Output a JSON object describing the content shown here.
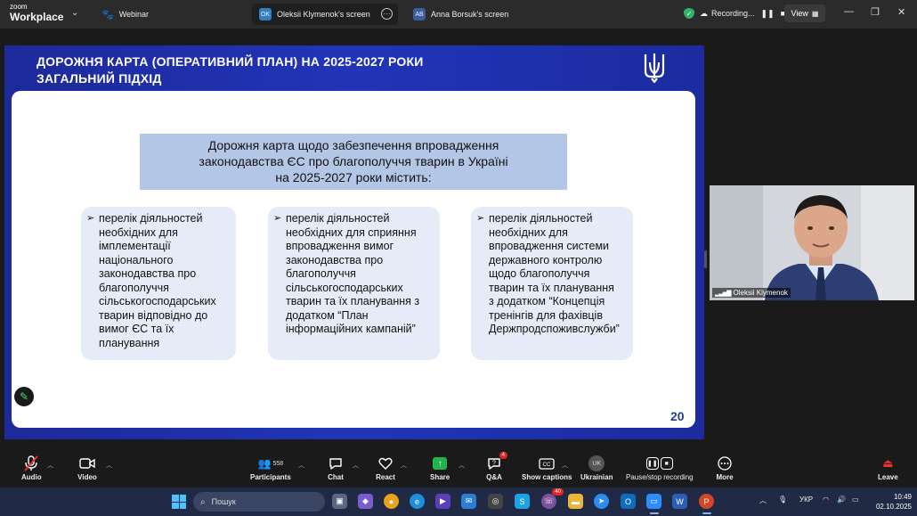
{
  "app": {
    "logo_line1": "zoom",
    "logo_line2": "Workplace",
    "tabs": [
      {
        "icon": "paw-icon",
        "label": "Webinar"
      },
      {
        "avatar": "OK",
        "label": "Oleksii Klymenok's screen",
        "avatar_color": "#2f7fc1"
      },
      {
        "avatar": "AB",
        "label": "Anna Borsuk's screen",
        "avatar_color": "#3b5d9c"
      }
    ],
    "recording_label": "Recording...",
    "view_label": "View"
  },
  "slide": {
    "title_line1": "ДОРОЖНЯ КАРТА (ОПЕРАТИВНИЙ ПЛАН) НА 2025-2027 РОКИ",
    "title_line2": "ЗАГАЛЬНИЙ ПІДХІД",
    "heading_line1": "Дорожня карта щодо забезпечення впровадження",
    "heading_line2": "законодавства ЄС про благополуччя тварин в Україні",
    "heading_line3": "на 2025-2027 роки містить:",
    "cards": [
      {
        "lines": [
          "перелік діяльностей",
          "необхідних для",
          "імплементації",
          "національного",
          "законодавства про",
          "благополуччя",
          "сільськогосподарських",
          "тварин відповідно до",
          "вимог ЄС та їх",
          "планування"
        ]
      },
      {
        "lines": [
          "перелік діяльностей",
          "необхідних для сприяння",
          "впровадження вимог",
          "законодавства про",
          "благополуччя",
          "сільськогосподарських",
          "тварин та їх планування з",
          "додатком “План",
          "інформаційних кампаній”"
        ]
      },
      {
        "lines": [
          "перелік діяльностей",
          "необхідних для",
          "впровадження системи",
          "державного контролю",
          "щодо благополуччя",
          "тварин та їх планування",
          "з додатком “Концепція",
          "тренінгів для фахівців",
          "Держпродспоживслужби”"
        ]
      }
    ],
    "page_number": "20",
    "colors": {
      "band": "#2234b8",
      "heading_bg": "#b4c6e6",
      "card_bg": "#e6ecf7",
      "page_num": "#1f3c8f"
    }
  },
  "video": {
    "participant_name": "Oleksii Klymenok"
  },
  "toolbar": {
    "audio": "Audio",
    "video": "Video",
    "participants": "Participants",
    "participants_count": "558",
    "chat": "Chat",
    "react": "React",
    "share": "Share",
    "qa": "Q&A",
    "qa_badge": "4",
    "captions": "Show captions",
    "language_code": "UK",
    "language": "Ukrainian",
    "pause_recording": "Pause/stop recording",
    "more": "More",
    "leave": "Leave"
  },
  "taskbar": {
    "search_placeholder": "Пошук",
    "viber_badge": "40",
    "keyboard_lang": "УКР",
    "time": "10:49",
    "date": "02.10.2025"
  }
}
